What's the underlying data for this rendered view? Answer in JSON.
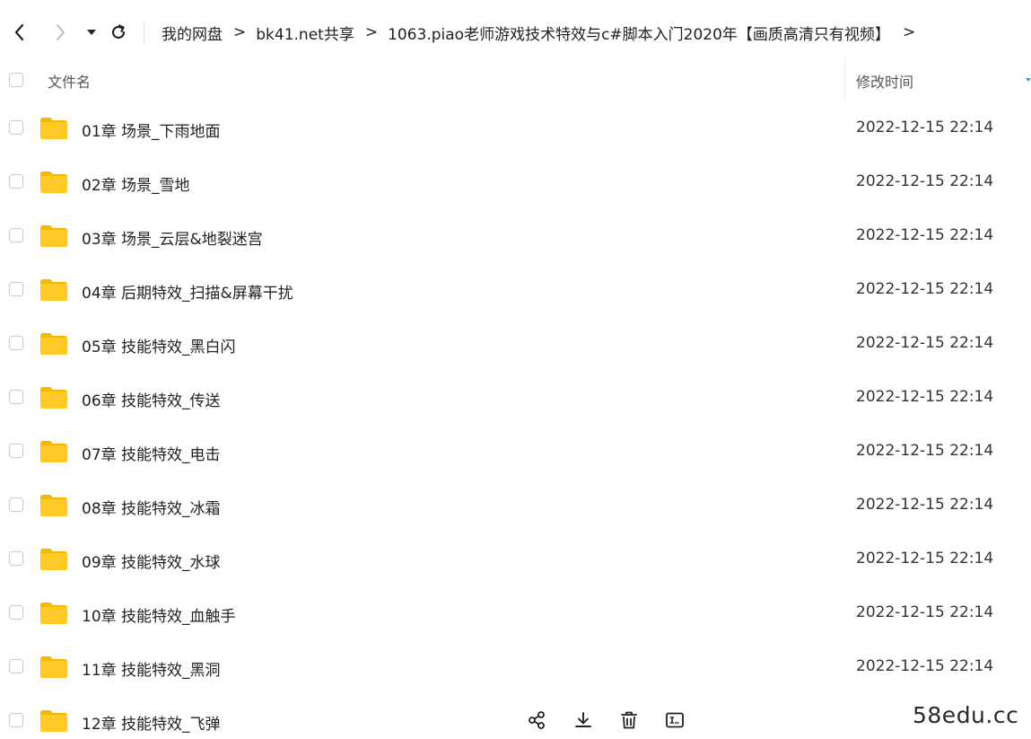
{
  "nav": {
    "back_icon": "chevron-left-icon",
    "forward_icon": "chevron-right-icon",
    "dropdown_icon": "caret-down-icon",
    "refresh_icon": "refresh-icon"
  },
  "breadcrumb": {
    "items": [
      "我的网盘",
      "bk41.net共享",
      "1063.piao老师游戏技术特效与c#脚本入门2020年【画质高清只有视频】"
    ],
    "separator": ">"
  },
  "table": {
    "col_name": "文件名",
    "col_time": "修改时间"
  },
  "files": [
    {
      "name": "01章 场景_下雨地面",
      "modified": "2022-12-15 22:14"
    },
    {
      "name": "02章 场景_雪地",
      "modified": "2022-12-15 22:14"
    },
    {
      "name": "03章 场景_云层&地裂迷宫",
      "modified": "2022-12-15 22:14"
    },
    {
      "name": "04章 后期特效_扫描&屏幕干扰",
      "modified": "2022-12-15 22:14"
    },
    {
      "name": "05章 技能特效_黑白闪",
      "modified": "2022-12-15 22:14"
    },
    {
      "name": "06章 技能特效_传送",
      "modified": "2022-12-15 22:14"
    },
    {
      "name": "07章 技能特效_电击",
      "modified": "2022-12-15 22:14"
    },
    {
      "name": "08章 技能特效_冰霜",
      "modified": "2022-12-15 22:14"
    },
    {
      "name": "09章 技能特效_水球",
      "modified": "2022-12-15 22:14"
    },
    {
      "name": "10章 技能特效_血触手",
      "modified": "2022-12-15 22:14"
    },
    {
      "name": "11章 技能特效_黑洞",
      "modified": "2022-12-15 22:14"
    },
    {
      "name": "12章 技能特效_飞弹",
      "modified": ""
    }
  ],
  "actions": [
    "share-icon",
    "download-icon",
    "delete-icon",
    "rename-icon"
  ],
  "watermark": "58edu.cc",
  "colors": {
    "folder": "#FFCA28",
    "folder_tab": "#F5B800",
    "accent": "#06A7FF"
  }
}
